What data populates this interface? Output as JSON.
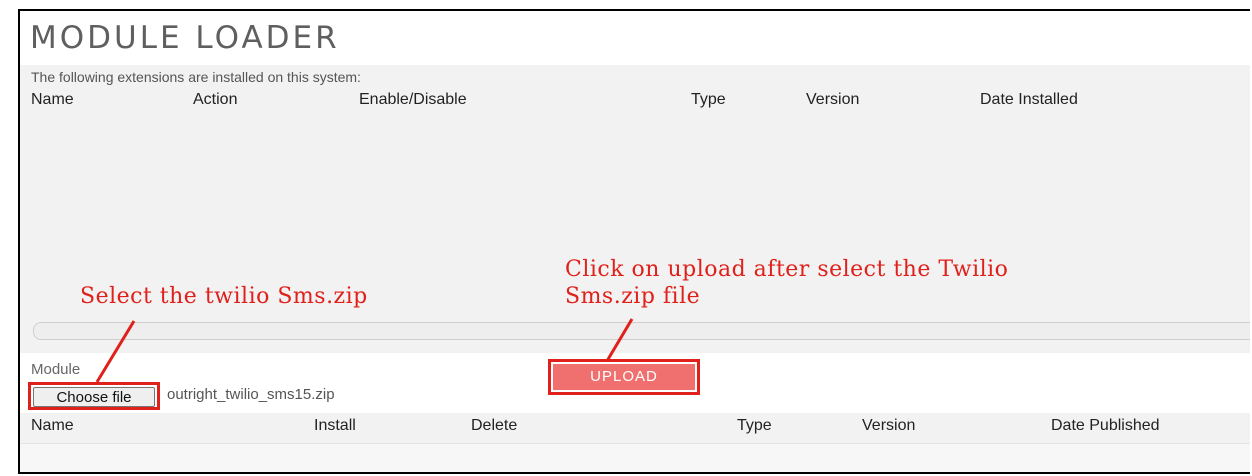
{
  "title": "MODULE LOADER",
  "installed": {
    "subtitle": "The following extensions are installed on this system:",
    "columns": [
      "Name",
      "Action",
      "Enable/Disable",
      "Type",
      "Version",
      "Date Installed"
    ]
  },
  "upload": {
    "module_label": "Module",
    "choose_button": "Choose file",
    "file_name": "outright_twilio_sms15.zip",
    "upload_button": "UPLOAD"
  },
  "available": {
    "columns": [
      "Name",
      "Install",
      "Delete",
      "Type",
      "Version",
      "Date Published"
    ]
  },
  "annotations": {
    "select": "Select the twilio Sms.zip",
    "upload_line1": "Click on upload after select the Twilio",
    "upload_line2": "Sms.zip file",
    "color": "#e0201a"
  }
}
